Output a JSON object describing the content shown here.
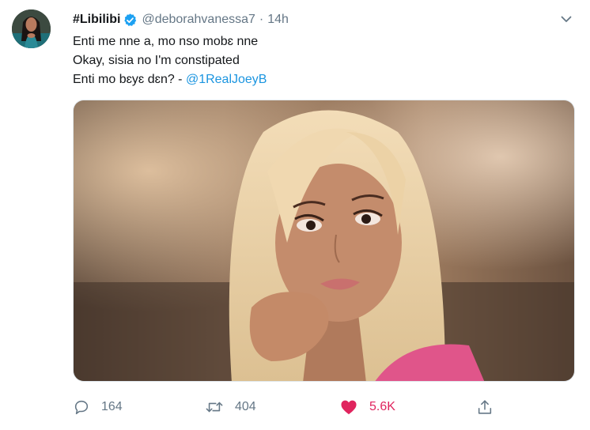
{
  "tweet": {
    "display_name": "#Libilibi",
    "handle": "@deborahvanessa7",
    "separator": "·",
    "time": "14h",
    "lines": [
      "Enti me nne a, mo nso mobɛ nne",
      "Okay, sisia no I'm constipated",
      "Enti mo bɛyɛ dɛn? - "
    ],
    "mention": "@1RealJoeyB"
  },
  "actions": {
    "replies": "164",
    "retweets": "404",
    "likes": "5.6K"
  },
  "icons": {
    "verified": "verified-badge-icon",
    "caret": "chevron-down-icon",
    "reply": "comment-bubble-icon",
    "retweet": "retweet-arrows-icon",
    "like": "heart-icon",
    "share": "share-upload-icon"
  },
  "colors": {
    "verified": "#1da1f2",
    "mention": "#1b95e0",
    "muted": "#657786",
    "like": "#e0245e"
  }
}
